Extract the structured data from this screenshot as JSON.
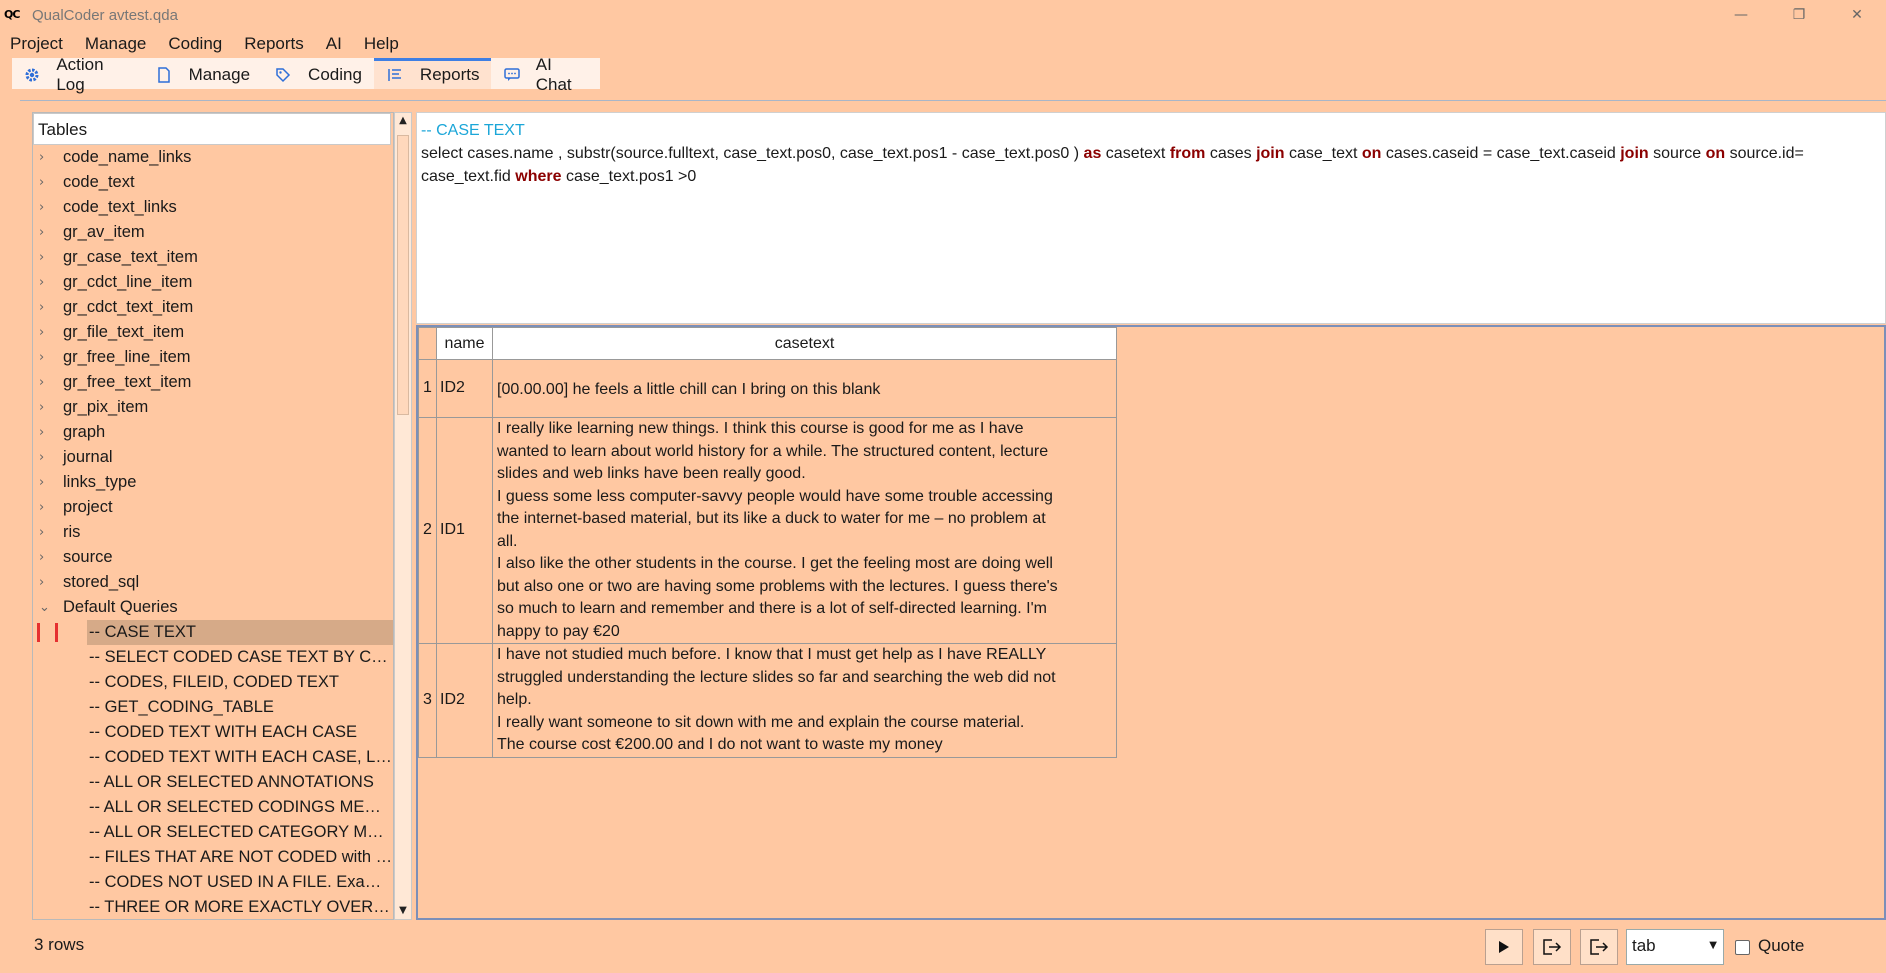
{
  "window": {
    "title": "QualCoder avtest.qda",
    "logo": "QC"
  },
  "menu": [
    "Project",
    "Manage",
    "Coding",
    "Reports",
    "AI",
    "Help"
  ],
  "tabs": [
    {
      "label": "Action Log",
      "icon": "gear-icon"
    },
    {
      "label": "Manage",
      "icon": "document-icon"
    },
    {
      "label": "Coding",
      "icon": "tag-icon"
    },
    {
      "label": "Reports",
      "icon": "list-icon"
    },
    {
      "label": "AI Chat",
      "icon": "chat-icon"
    }
  ],
  "active_tab": "Reports",
  "tree": {
    "header": "Tables",
    "tables": [
      "code_name_links",
      "code_text",
      "code_text_links",
      "gr_av_item",
      "gr_case_text_item",
      "gr_cdct_line_item",
      "gr_cdct_text_item",
      "gr_file_text_item",
      "gr_free_line_item",
      "gr_free_text_item",
      "gr_pix_item",
      "graph",
      "journal",
      "links_type",
      "project",
      "ris",
      "source",
      "stored_sql"
    ],
    "group_label": "Default Queries",
    "queries": [
      "-- CASE TEXT",
      "-- SELECT CODED CASE TEXT BY CODE ...",
      "-- CODES, FILEID, CODED TEXT",
      "-- GET_CODING_TABLE",
      "-- CODED TEXT WITH EACH CASE",
      "-- CODED TEXT WITH EACH CASE, LIMI...",
      "-- ALL OR SELECTED ANNOTATIONS",
      "-- ALL OR SELECTED CODINGS MEMOS",
      "-- ALL OR SELECTED CATEGORY MEMOS",
      "-- FILES THAT ARE NOT CODED with c...",
      "-- CODES NOT USED IN A FILE. Exampl...",
      "-- THREE OR MORE EXACTLY OVERLAP..."
    ],
    "selected_query": "-- CASE TEXT"
  },
  "sql": {
    "comment": "-- CASE TEXT",
    "tokens": [
      {
        "t": "select cases.name ,  substr(source.fulltext, case_text.pos0, case_text.pos1 -  case_text.pos0 ) ",
        "k": false
      },
      {
        "t": "as",
        "k": true
      },
      {
        "t": " casetext ",
        "k": false
      },
      {
        "t": "from",
        "k": true
      },
      {
        "t": " cases ",
        "k": false
      },
      {
        "t": "join",
        "k": true
      },
      {
        "t": " case_text ",
        "k": false
      },
      {
        "t": "on",
        "k": true
      },
      {
        "t": "  cases.caseid = case_text.caseid ",
        "k": false
      },
      {
        "t": "join",
        "k": true
      },
      {
        "t": " source ",
        "k": false
      },
      {
        "t": "on",
        "k": true
      },
      {
        "t": " source.id= case_text.fid ",
        "k": false
      },
      {
        "t": "where",
        "k": true
      },
      {
        "t": " case_text.pos1 >0",
        "k": false
      }
    ]
  },
  "results": {
    "columns": [
      "name",
      "casetext"
    ],
    "rows": [
      {
        "n": "1",
        "name": "ID2",
        "lines": [
          "",
          "[00.00.00] he feels a little chill can I bring on this blank"
        ]
      },
      {
        "n": "2",
        "name": "ID1",
        "lines": [
          "I really like learning new things. I think this course is good for me as I have",
          "wanted to learn about world history for a while. The structured content, lecture",
          "slides and web links have been really good.",
          "I guess some less computer-savvy people would have some trouble accessing",
          "the internet-based material, but its like a duck to water for me – no problem at",
          "all.",
          "I also like the other students in the course. I get the feeling most are doing well",
          "but also one or two are having some problems with the lectures. I guess there's",
          "so much to learn and remember and there is a lot of self-directed learning. I'm",
          "happy to pay €20"
        ]
      },
      {
        "n": "3",
        "name": "ID2",
        "lines": [
          "I have not studied much before. I know that I must get help as I have REALLY",
          "struggled understanding the lecture slides so far and searching the web did not",
          "help.",
          "I really want someone to sit down with me and explain the course material.",
          "The course cost €200.00 and I do not want to waste my money"
        ]
      }
    ]
  },
  "footer": {
    "row_count": "3 rows",
    "delimiter": "tab",
    "quote_label": "Quote"
  },
  "colors": {
    "background": "#ffc8a2",
    "accent": "#3f7fe3",
    "sql_keyword": "#8b0000",
    "sql_comment": "#1ba6d8"
  }
}
